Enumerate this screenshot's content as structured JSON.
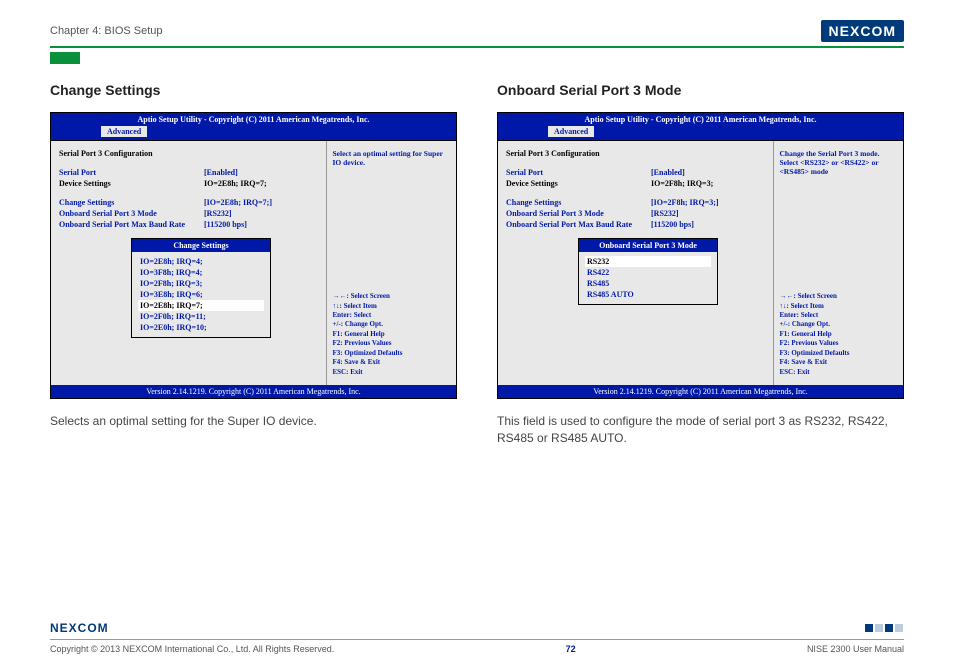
{
  "header": {
    "chapter": "Chapter 4: BIOS Setup",
    "brand": "NEXCOM"
  },
  "left": {
    "title": "Change Settings",
    "bios": {
      "top": "Aptio Setup Utility - Copyright (C) 2011 American Megatrends, Inc.",
      "tab": "Advanced",
      "cfg_title": "Serial Port 3 Configuration",
      "rows": [
        {
          "label": "Serial Port",
          "val": "[Enabled]",
          "lcolor": "blue",
          "vcolor": "blue"
        },
        {
          "label": "Device Settings",
          "val": "IO=2E8h; IRQ=7;",
          "lcolor": "black",
          "vcolor": "black"
        }
      ],
      "rows2": [
        {
          "label": "Change Settings",
          "val": "[IO=2E8h; IRQ=7;]"
        },
        {
          "label": "Onboard Serial Port 3 Mode",
          "val": "[RS232]"
        },
        {
          "label": "Onboard Serial Port Max Baud Rate",
          "val": "[115200 bps]"
        }
      ],
      "popup": {
        "title": "Change Settings",
        "items": [
          "IO=2E8h; IRQ=4;",
          "IO=3F8h; IRQ=4;",
          "IO=2F8h; IRQ=3;",
          "IO=3E8h; IRQ=6;",
          "IO=2E8h; IRQ=7;",
          "IO=2F0h; IRQ=11;",
          "IO=2E0h; IRQ=10;"
        ],
        "selected": 4
      },
      "help_top": "Select an optimal setting for Super IO device.",
      "help_keys": "→←: Select Screen\n↑↓: Select Item\nEnter: Select\n+/-: Change Opt.\nF1: General Help\nF2: Previous Values\nF3: Optimized Defaults\nF4: Save & Exit\nESC: Exit",
      "bottom": "Version 2.14.1219. Copyright (C) 2011 American Megatrends, Inc."
    },
    "desc": "Selects an optimal setting for the Super IO device."
  },
  "right": {
    "title": "Onboard Serial Port 3 Mode",
    "bios": {
      "top": "Aptio Setup Utility - Copyright (C) 2011 American Megatrends, Inc.",
      "tab": "Advanced",
      "cfg_title": "Serial Port 3 Configuration",
      "rows": [
        {
          "label": "Serial Port",
          "val": "[Enabled]",
          "lcolor": "blue",
          "vcolor": "blue"
        },
        {
          "label": "Device Settings",
          "val": "IO=2F8h; IRQ=3;",
          "lcolor": "black",
          "vcolor": "black"
        }
      ],
      "rows2": [
        {
          "label": "Change Settings",
          "val": "[IO=2F8h; IRQ=3;]"
        },
        {
          "label": "Onboard Serial Port 3 Mode",
          "val": "[RS232]"
        },
        {
          "label": "Onboard Serial Port Max Baud Rate",
          "val": "[115200 bps]"
        }
      ],
      "popup": {
        "title": "Onboard Serial Port 3 Mode",
        "items": [
          "RS232",
          "RS422",
          "RS485",
          "RS485 AUTO"
        ],
        "selected": 0
      },
      "help_top": "Change the Serial Port 3 mode. Select <RS232> or <RS422> or <RS485> mode",
      "help_keys": "→←: Select Screen\n↑↓: Select Item\nEnter: Select\n+/-: Change Opt.\nF1: General Help\nF2: Previous Values\nF3: Optimized Defaults\nF4: Save & Exit\nESC: Exit",
      "bottom": "Version 2.14.1219. Copyright (C) 2011 American Megatrends, Inc."
    },
    "desc": "This field is used to configure the mode of serial port 3 as RS232, RS422, RS485 or RS485 AUTO."
  },
  "footer": {
    "brand": "NEXCOM",
    "copyright": "Copyright © 2013 NEXCOM International Co., Ltd. All Rights Reserved.",
    "page": "72",
    "manual": "NISE 2300 User Manual"
  }
}
